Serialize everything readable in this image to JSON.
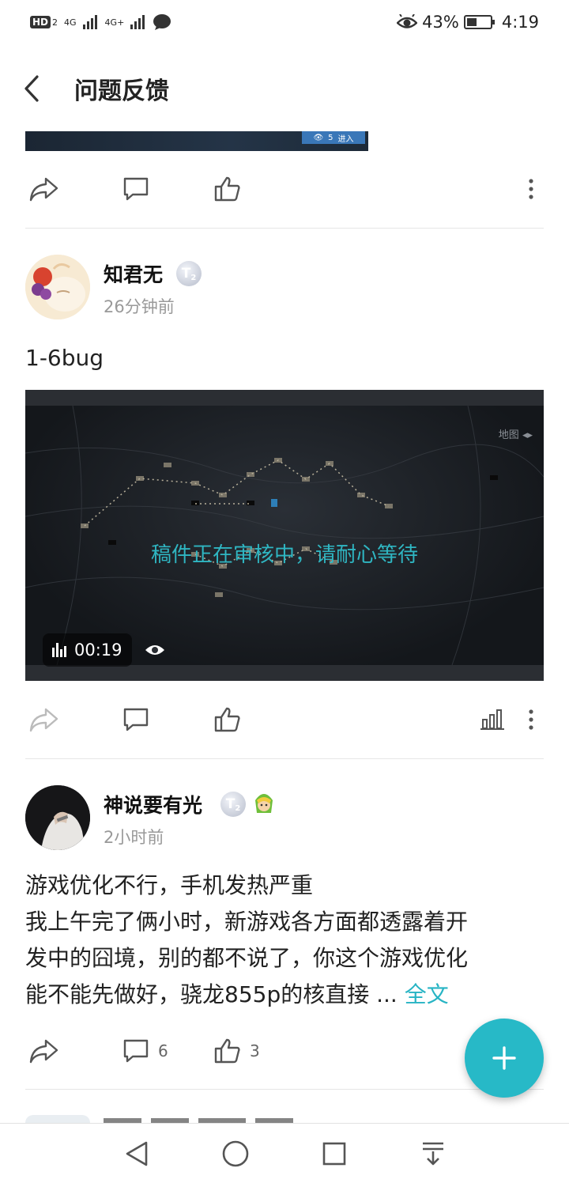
{
  "status_bar": {
    "hd_label": "HD",
    "hd_sub": "2",
    "signal_1": "4G",
    "signal_2": "4G+",
    "battery_percent": "43%",
    "battery_level": 0.43,
    "time": "4:19",
    "icons": [
      "chat-icon",
      "eye-icon",
      "battery-icon"
    ]
  },
  "header": {
    "title": "问题反馈"
  },
  "post_top": {
    "thumb_badge_count": "5",
    "thumb_badge_label": "进入"
  },
  "post_1": {
    "author": "知君无",
    "level": "2",
    "time": "26分钟前",
    "text": "1-6bug",
    "video": {
      "review_status": "稿件正在审核中，请耐心等待",
      "duration": "00:19",
      "map_label": "地图"
    }
  },
  "post_2": {
    "author": "神说要有光",
    "level": "2",
    "time": "2小时前",
    "title": "游戏优化不行，手机发热严重",
    "body_line_1": "我上午完了俩小时，新游戏各方面都透露着开",
    "body_line_2": "发中的囧境，别的都不说了，你这个游戏优化",
    "body_line_3": "能不能先做好，骁龙855p的核直接 ...",
    "read_more": "全文",
    "comment_count": "6",
    "like_count": "3"
  },
  "colors": {
    "accent": "#27b9c7",
    "link": "#27b4c4",
    "review_text": "#2fb6c2"
  }
}
